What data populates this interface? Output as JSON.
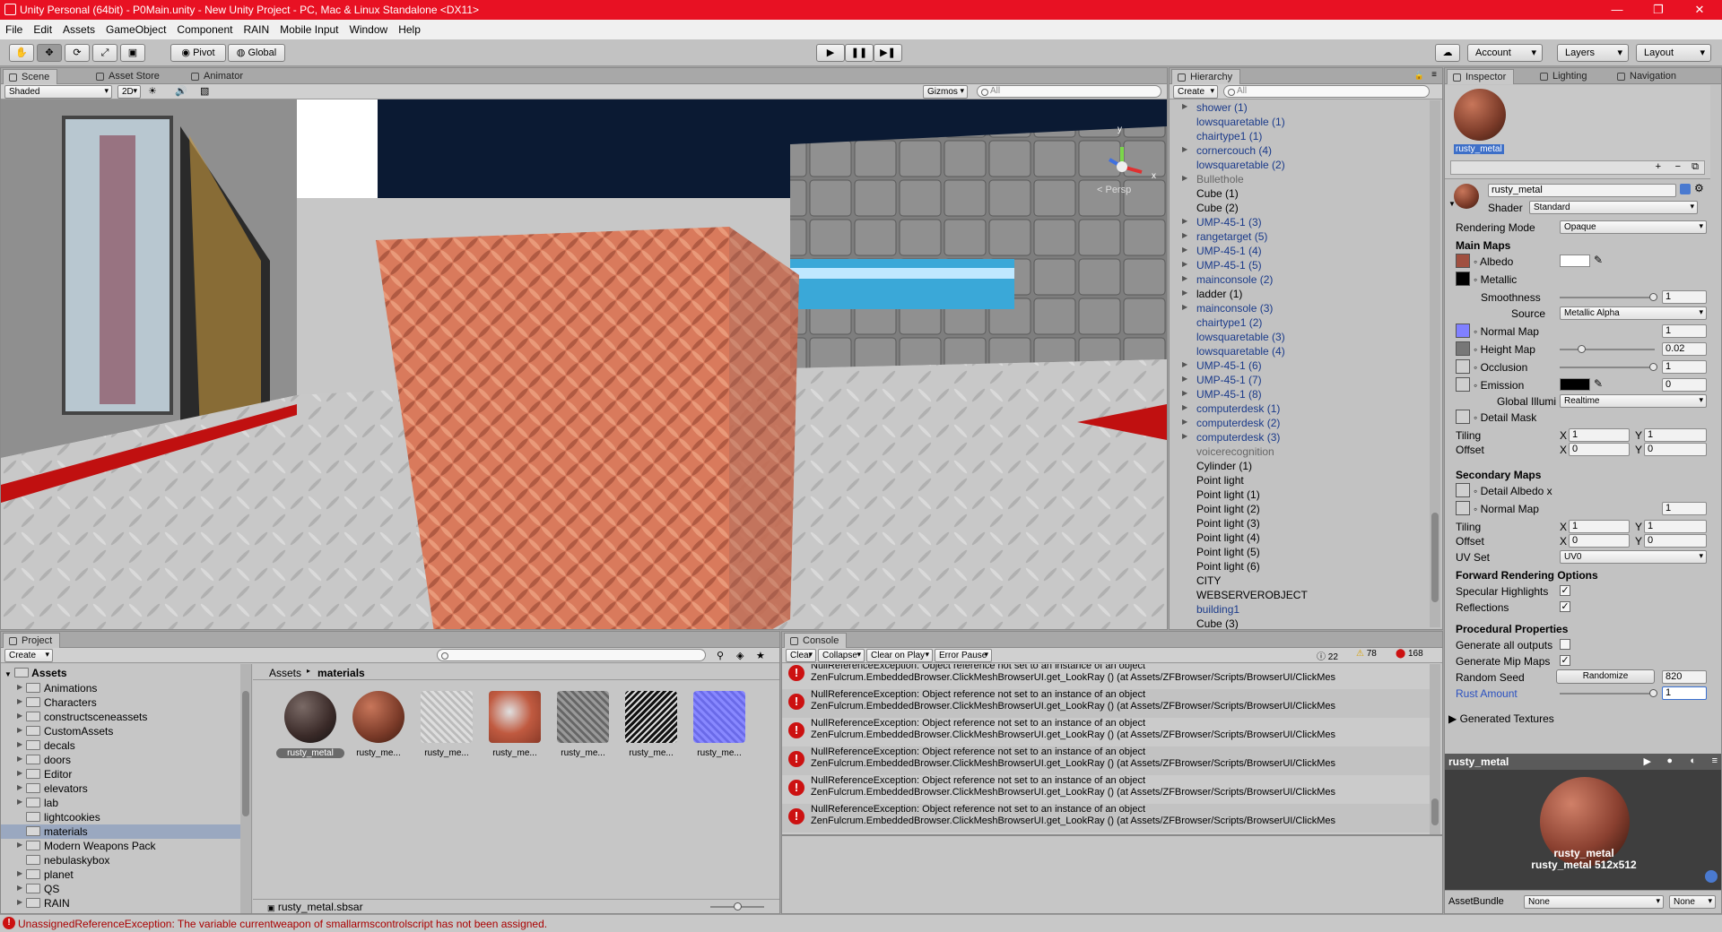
{
  "window": {
    "title": "Unity Personal (64bit) - P0Main.unity - New Unity Project - PC, Mac & Linux Standalone <DX11>"
  },
  "menu": [
    "File",
    "Edit",
    "Assets",
    "GameObject",
    "Component",
    "RAIN",
    "Mobile Input",
    "Window",
    "Help"
  ],
  "toolbar": {
    "pivot": "Pivot",
    "global": "Global",
    "account": "Account",
    "layers": "Layers",
    "layout": "Layout"
  },
  "scene": {
    "tabs": [
      "Scene",
      "Asset Store",
      "Animator"
    ],
    "shading": "Shaded",
    "mode2d": "2D",
    "gizmos": "Gizmos",
    "search_placeholder": "All",
    "persp": "< Persp"
  },
  "hierarchy": {
    "tab": "Hierarchy",
    "create": "Create",
    "search_placeholder": "All",
    "items": [
      {
        "name": "shower (1)",
        "arrow": true,
        "style": "blue"
      },
      {
        "name": "lowsquaretable (1)",
        "arrow": false,
        "style": "blue"
      },
      {
        "name": "chairtype1 (1)",
        "arrow": false,
        "style": "blue"
      },
      {
        "name": "cornercouch (4)",
        "arrow": true,
        "style": "blue"
      },
      {
        "name": "lowsquaretable (2)",
        "arrow": false,
        "style": "blue"
      },
      {
        "name": "Bullethole",
        "arrow": true,
        "style": "gray"
      },
      {
        "name": "Cube (1)",
        "arrow": false,
        "style": "black"
      },
      {
        "name": "Cube (2)",
        "arrow": false,
        "style": "black"
      },
      {
        "name": "UMP-45-1 (3)",
        "arrow": true,
        "style": "blue"
      },
      {
        "name": "rangetarget (5)",
        "arrow": true,
        "style": "blue"
      },
      {
        "name": "UMP-45-1 (4)",
        "arrow": true,
        "style": "blue"
      },
      {
        "name": "UMP-45-1 (5)",
        "arrow": true,
        "style": "blue"
      },
      {
        "name": "mainconsole (2)",
        "arrow": true,
        "style": "blue"
      },
      {
        "name": "ladder (1)",
        "arrow": true,
        "style": "black"
      },
      {
        "name": "mainconsole (3)",
        "arrow": true,
        "style": "blue"
      },
      {
        "name": "chairtype1 (2)",
        "arrow": false,
        "style": "blue"
      },
      {
        "name": "lowsquaretable (3)",
        "arrow": false,
        "style": "blue"
      },
      {
        "name": "lowsquaretable (4)",
        "arrow": false,
        "style": "blue"
      },
      {
        "name": "UMP-45-1 (6)",
        "arrow": true,
        "style": "blue"
      },
      {
        "name": "UMP-45-1 (7)",
        "arrow": true,
        "style": "blue"
      },
      {
        "name": "UMP-45-1 (8)",
        "arrow": true,
        "style": "blue"
      },
      {
        "name": "computerdesk (1)",
        "arrow": true,
        "style": "blue"
      },
      {
        "name": "computerdesk (2)",
        "arrow": true,
        "style": "blue"
      },
      {
        "name": "computerdesk (3)",
        "arrow": true,
        "style": "blue"
      },
      {
        "name": "voicerecognition",
        "arrow": false,
        "style": "gray"
      },
      {
        "name": "Cylinder (1)",
        "arrow": false,
        "style": "black"
      },
      {
        "name": "Point light",
        "arrow": false,
        "style": "black"
      },
      {
        "name": "Point light (1)",
        "arrow": false,
        "style": "black"
      },
      {
        "name": "Point light (2)",
        "arrow": false,
        "style": "black"
      },
      {
        "name": "Point light (3)",
        "arrow": false,
        "style": "black"
      },
      {
        "name": "Point light (4)",
        "arrow": false,
        "style": "black"
      },
      {
        "name": "Point light (5)",
        "arrow": false,
        "style": "black"
      },
      {
        "name": "Point light (6)",
        "arrow": false,
        "style": "black"
      },
      {
        "name": "CITY",
        "arrow": false,
        "style": "black"
      },
      {
        "name": "WEBSERVEROBJECT",
        "arrow": false,
        "style": "black"
      },
      {
        "name": "building1",
        "arrow": false,
        "style": "blue"
      },
      {
        "name": "Cube (3)",
        "arrow": false,
        "style": "black"
      }
    ]
  },
  "inspector": {
    "tabs": [
      "Inspector",
      "Lighting",
      "Navigation"
    ],
    "asset_label": "rusty_metal",
    "material_name": "rusty_metal",
    "shader_label": "Shader",
    "shader_value": "Standard",
    "rendering_mode_label": "Rendering Mode",
    "rendering_mode_value": "Opaque",
    "main_maps": "Main Maps",
    "albedo": "Albedo",
    "metallic": "Metallic",
    "smoothness": "Smoothness",
    "smoothness_value": "1",
    "source": "Source",
    "source_value": "Metallic Alpha",
    "normal_map": "Normal Map",
    "normal_value": "1",
    "height_map": "Height Map",
    "height_value": "0.02",
    "occlusion": "Occlusion",
    "occlusion_value": "1",
    "emission": "Emission",
    "emission_value": "0",
    "global_illum": "Global Illumi",
    "global_illum_value": "Realtime",
    "detail_mask": "Detail Mask",
    "tiling": "Tiling",
    "offset": "Offset",
    "x": "X",
    "y": "Y",
    "tiling_x": "1",
    "tiling_y": "1",
    "offset_x": "0",
    "offset_y": "0",
    "secondary_maps": "Secondary Maps",
    "detail_albedo": "Detail Albedo x",
    "normal_map2": "Normal Map",
    "normal2_value": "1",
    "tiling2_x": "1",
    "tiling2_y": "1",
    "offset2_x": "0",
    "offset2_y": "0",
    "uv_set": "UV Set",
    "uv_set_value": "UV0",
    "forward": "Forward Rendering Options",
    "specular": "Specular Highlights",
    "reflections": "Reflections",
    "procedural": "Procedural Properties",
    "gen_outputs": "Generate all outputs",
    "gen_mip": "Generate Mip Maps",
    "random_seed": "Random Seed",
    "randomize": "Randomize",
    "seed_value": "820",
    "rust_amount": "Rust Amount",
    "rust_value": "1",
    "generated_textures": "Generated Textures",
    "preview_title": "rusty_metal",
    "preview_name": "rusty_metal",
    "preview_info": "rusty_metal   512x512",
    "assetbundle": "AssetBundle",
    "none1": "None",
    "none2": "None"
  },
  "project": {
    "tab": "Project",
    "create": "Create",
    "breadcrumb": [
      "Assets",
      "materials"
    ],
    "root": "Assets",
    "folders": [
      {
        "name": "Animations",
        "arrow": true
      },
      {
        "name": "Characters",
        "arrow": true
      },
      {
        "name": "constructsceneassets",
        "arrow": true
      },
      {
        "name": "CustomAssets",
        "arrow": true
      },
      {
        "name": "decals",
        "arrow": true
      },
      {
        "name": "doors",
        "arrow": true
      },
      {
        "name": "Editor",
        "arrow": true
      },
      {
        "name": "elevators",
        "arrow": true
      },
      {
        "name": "lab",
        "arrow": true
      },
      {
        "name": "lightcookies",
        "arrow": false
      },
      {
        "name": "materials",
        "arrow": false
      },
      {
        "name": "Modern Weapons Pack",
        "arrow": true
      },
      {
        "name": "nebulaskybox",
        "arrow": false
      },
      {
        "name": "planet",
        "arrow": true
      },
      {
        "name": "QS",
        "arrow": true
      },
      {
        "name": "RAIN",
        "arrow": true
      }
    ],
    "thumbs": [
      "rusty_metal",
      "rusty_me...",
      "rusty_me...",
      "rusty_me...",
      "rusty_me...",
      "rusty_me...",
      "rusty_me..."
    ],
    "selected_file": "rusty_metal.sbsar"
  },
  "console": {
    "tab": "Console",
    "buttons": [
      "Clear",
      "Collapse",
      "Clear on Play",
      "Error Pause"
    ],
    "count_info": "22",
    "count_warn": "78",
    "count_err": "168",
    "line1": "NullReferenceException: Object reference not set to an instance of an object",
    "line2": "ZenFulcrum.EmbeddedBrowser.ClickMeshBrowserUI.get_LookRay () (at Assets/ZFBrowser/Scripts/BrowserUI/ClickMes",
    "rows": 6
  },
  "status": {
    "message": "UnassignedReferenceException: The variable currentweapon of smallarmscontrolscript has not been assigned."
  },
  "colors": {
    "titlebar": "#e81123",
    "error": "#cc1111",
    "link_blue": "#1a3a8a"
  }
}
